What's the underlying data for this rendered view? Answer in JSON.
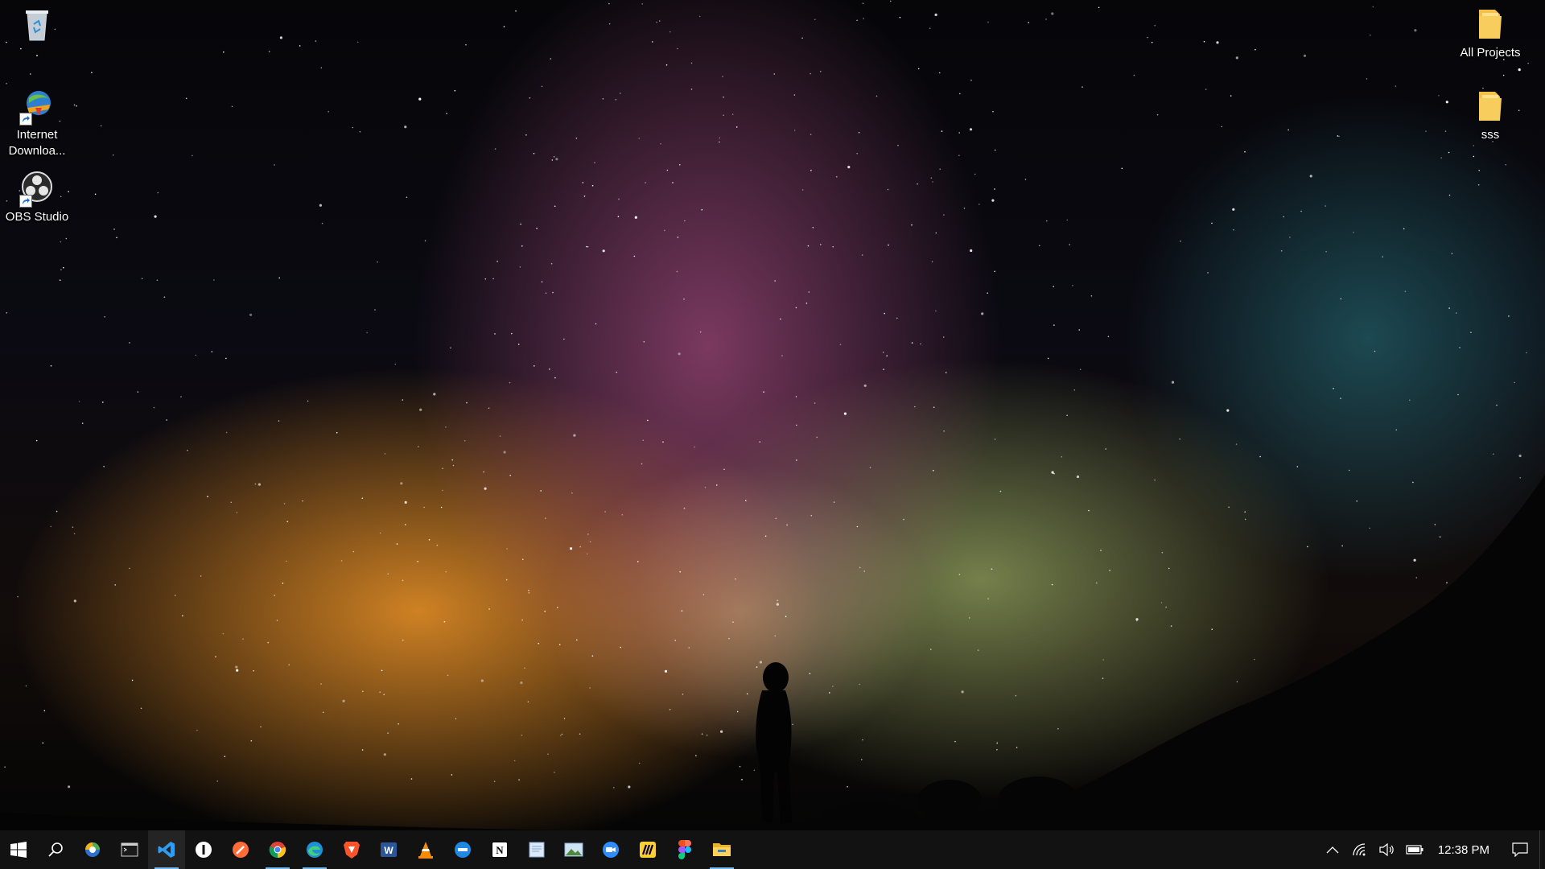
{
  "desktop": {
    "icons_left": [
      {
        "label": ".",
        "icon": "recycle-bin-icon"
      },
      {
        "label": "Internet Downloa...",
        "icon": "internet-download-manager-icon"
      },
      {
        "label": "OBS Studio",
        "icon": "obs-studio-icon"
      }
    ],
    "icons_right": [
      {
        "label": "All Projects",
        "icon": "folder-icon"
      },
      {
        "label": "sss",
        "icon": "folder-icon"
      }
    ]
  },
  "taskbar": {
    "apps": [
      {
        "name": "start",
        "icon": "windows-start-icon"
      },
      {
        "name": "search",
        "icon": "search-icon"
      },
      {
        "name": "photos",
        "icon": "photos-app-icon"
      },
      {
        "name": "terminal",
        "icon": "terminal-icon"
      },
      {
        "name": "vs-code",
        "icon": "vscode-icon",
        "running": true,
        "active": true
      },
      {
        "name": "dark-app",
        "icon": "dark-circle-app-icon"
      },
      {
        "name": "postman",
        "icon": "postman-icon"
      },
      {
        "name": "chrome",
        "icon": "chrome-icon",
        "running": true
      },
      {
        "name": "edge",
        "icon": "edge-icon",
        "running": true
      },
      {
        "name": "brave",
        "icon": "brave-icon"
      },
      {
        "name": "word",
        "icon": "word-icon"
      },
      {
        "name": "vlc",
        "icon": "vlc-icon"
      },
      {
        "name": "blue-app",
        "icon": "blue-circle-app-icon"
      },
      {
        "name": "notion",
        "icon": "notion-icon"
      },
      {
        "name": "notepad",
        "icon": "notepad-icon"
      },
      {
        "name": "image-viewer",
        "icon": "image-viewer-icon"
      },
      {
        "name": "zoom",
        "icon": "zoom-icon"
      },
      {
        "name": "miro",
        "icon": "miro-icon"
      },
      {
        "name": "figma",
        "icon": "figma-icon"
      },
      {
        "name": "file-explorer",
        "icon": "file-explorer-icon",
        "running": true
      }
    ],
    "tray": {
      "icons": [
        "chevron-up-icon",
        "wifi-icon",
        "volume-icon",
        "battery-icon"
      ],
      "clock": "12:38 PM",
      "notification_icon": "action-center-icon"
    }
  },
  "colors": {
    "taskbar_bg": "#121212",
    "running_indicator": "#76b9ed",
    "desktop_text": "#ffffff"
  }
}
